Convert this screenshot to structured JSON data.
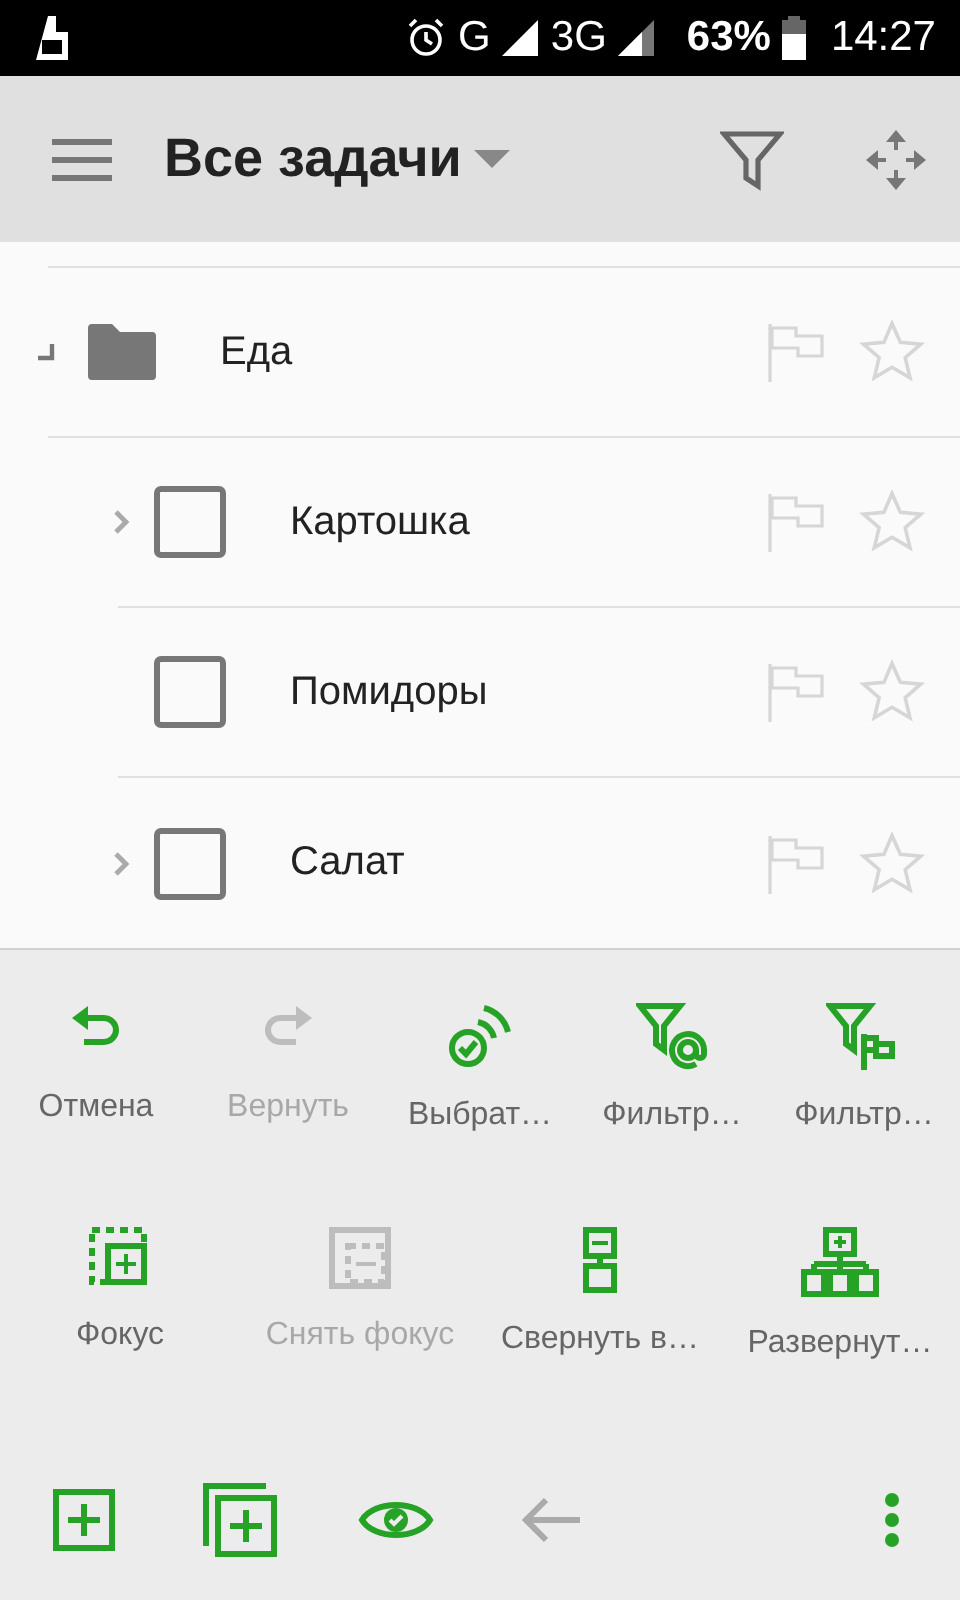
{
  "status_bar": {
    "network_1": "G",
    "network_2": "3G",
    "battery": "63%",
    "time": "14:27"
  },
  "app_bar": {
    "title": "Все задачи"
  },
  "tree": [
    {
      "kind": "folder",
      "label": "Еда",
      "expanded": true,
      "flagged": false,
      "starred": false,
      "children": [
        {
          "kind": "task",
          "label": "Картошка",
          "checked": false,
          "flagged": false,
          "starred": false,
          "has_children": true
        },
        {
          "kind": "task",
          "label": "Помидоры",
          "checked": false,
          "flagged": false,
          "starred": false,
          "has_children": false
        },
        {
          "kind": "task",
          "label": "Салат",
          "checked": false,
          "flagged": false,
          "starred": false,
          "has_children": true
        }
      ]
    }
  ],
  "actions_row_1": [
    {
      "label": "Отмена",
      "disabled": false
    },
    {
      "label": "Вернуть",
      "disabled": true
    },
    {
      "label": "Выбрат…",
      "disabled": false
    },
    {
      "label": "Фильтр…",
      "disabled": false
    },
    {
      "label": "Фильтр…",
      "disabled": false
    }
  ],
  "actions_row_2": [
    {
      "label": "Фокус",
      "disabled": false
    },
    {
      "label": "Снять фокус",
      "disabled": true
    },
    {
      "label": "Свернуть в…",
      "disabled": false
    },
    {
      "label": "Развернут…",
      "disabled": false
    }
  ],
  "bottom_bar": [
    {
      "disabled": false
    },
    {
      "disabled": false
    },
    {
      "disabled": false
    },
    {
      "disabled": true
    },
    {
      "disabled": false
    }
  ]
}
